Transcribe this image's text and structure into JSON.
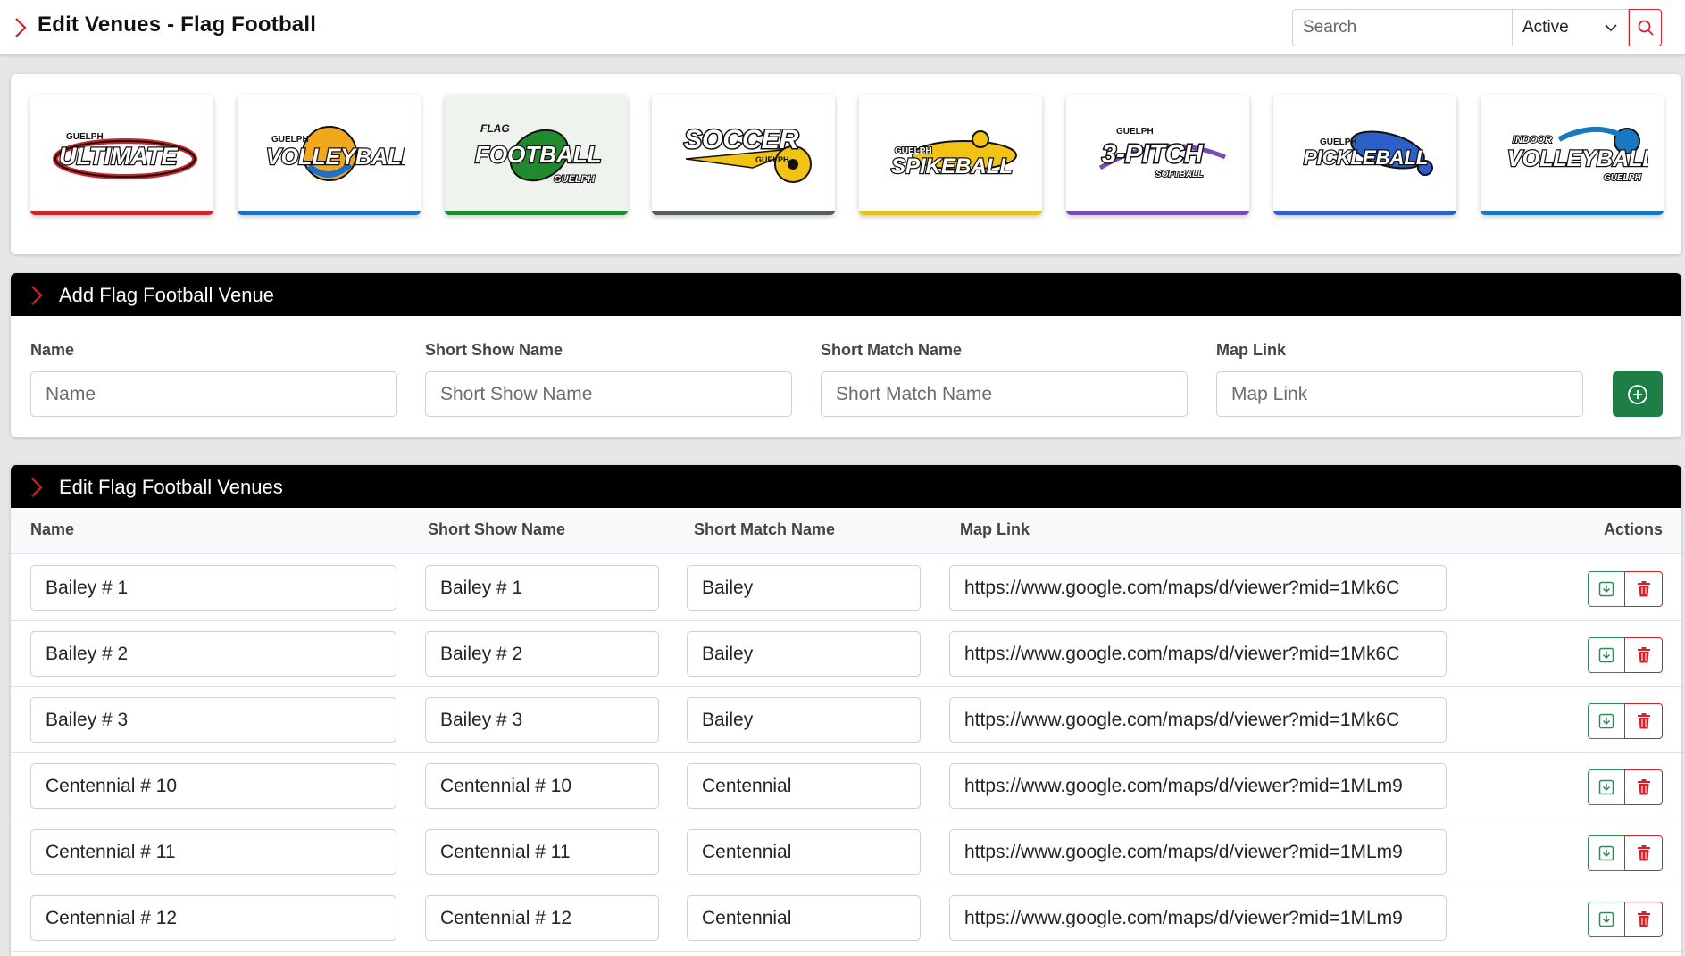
{
  "header": {
    "title": "Edit Venues - Flag Football",
    "search_placeholder": "Search",
    "status_filter": "Active"
  },
  "sports": [
    {
      "name": "Guelph Ultimate",
      "logo_top": "GUELPH",
      "logo_main": "ULTIMATE",
      "accent": "#d0232a",
      "active": false,
      "icon": "ultimate-logo"
    },
    {
      "name": "Guelph Volleyball",
      "logo_top": "GUELPH",
      "logo_main": "VOLLEYBALL",
      "accent": "#1e6fc7",
      "active": false,
      "icon": "volleyball-logo"
    },
    {
      "name": "Flag Football Guelph",
      "logo_top": "FLAG",
      "logo_main": "FOOTBALL",
      "logo_bottom": "GUELPH",
      "accent": "#1f8a2e",
      "active": true,
      "icon": "flag-football-logo"
    },
    {
      "name": "Soccer Guelph",
      "logo_main": "SOCCER",
      "logo_bottom": "GUELPH",
      "accent": "#555b61",
      "active": false,
      "icon": "soccer-logo"
    },
    {
      "name": "Guelph Spikeball",
      "logo_top": "GUELPH",
      "logo_main": "SPIKEBALL",
      "accent": "#e8c21a",
      "active": false,
      "icon": "spikeball-logo"
    },
    {
      "name": "Guelph 3-Pitch Softball",
      "logo_top": "GUELPH",
      "logo_main": "3-PITCH",
      "logo_bottom": "SOFTBALL",
      "accent": "#7a4bb5",
      "active": false,
      "icon": "three-pitch-logo"
    },
    {
      "name": "Guelph Pickleball",
      "logo_top": "GUELPH",
      "logo_main": "PICKLEBALL",
      "accent": "#2d5fc9",
      "active": false,
      "icon": "pickleball-logo"
    },
    {
      "name": "Indoor Volleyball Guelph",
      "logo_top": "INDOOR",
      "logo_main": "VOLLEYBALL",
      "logo_bottom": "GUELPH",
      "accent": "#1a78c2",
      "active": false,
      "icon": "indoor-volleyball-logo"
    }
  ],
  "add_section": {
    "title": "Add Flag Football Venue",
    "fields": [
      {
        "label": "Name",
        "placeholder": "Name"
      },
      {
        "label": "Short Show Name",
        "placeholder": "Short Show Name"
      },
      {
        "label": "Short Match Name",
        "placeholder": "Short Match Name"
      },
      {
        "label": "Map Link",
        "placeholder": "Map Link"
      }
    ],
    "add_icon": "plus-circle-icon"
  },
  "edit_section": {
    "title": "Edit Flag Football Venues",
    "columns": [
      "Name",
      "Short Show Name",
      "Short Match Name",
      "Map Link",
      "Actions"
    ],
    "rows": [
      {
        "name": "Bailey # 1",
        "show": "Bailey # 1",
        "match": "Bailey",
        "map": "https://www.google.com/maps/d/viewer?mid=1Mk6C"
      },
      {
        "name": "Bailey # 2",
        "show": "Bailey # 2",
        "match": "Bailey",
        "map": "https://www.google.com/maps/d/viewer?mid=1Mk6C"
      },
      {
        "name": "Bailey # 3",
        "show": "Bailey # 3",
        "match": "Bailey",
        "map": "https://www.google.com/maps/d/viewer?mid=1Mk6C"
      },
      {
        "name": "Centennial # 10",
        "show": "Centennial # 10",
        "match": "Centennial",
        "map": "https://www.google.com/maps/d/viewer?mid=1MLm9"
      },
      {
        "name": "Centennial # 11",
        "show": "Centennial # 11",
        "match": "Centennial",
        "map": "https://www.google.com/maps/d/viewer?mid=1MLm9"
      },
      {
        "name": "Centennial # 12",
        "show": "Centennial # 12",
        "match": "Centennial",
        "map": "https://www.google.com/maps/d/viewer?mid=1MLm9"
      }
    ],
    "save_icon": "download-icon",
    "delete_icon": "trash-icon"
  },
  "colors": {
    "brand_red": "#d0232a",
    "action_green": "#1e7e45",
    "header_black": "#000000"
  }
}
